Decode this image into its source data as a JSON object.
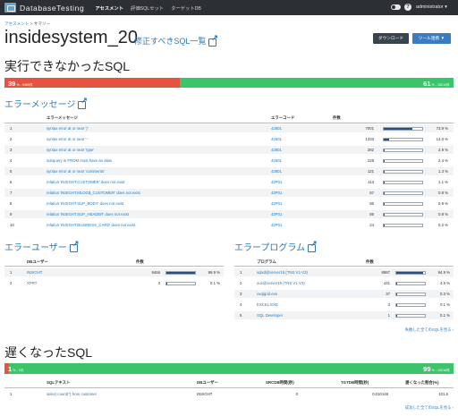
{
  "topbar": {
    "brand": "DatabaseTesting",
    "nav": [
      "アセスメント",
      "評価SQLセット",
      "ターゲットDB"
    ],
    "help": "?",
    "user": "administrator ▾"
  },
  "breadcrumb": {
    "root": "アセスメント",
    "sep": ">",
    "current": "サマリー"
  },
  "page": {
    "title": "insidesystem_20",
    "fix_link": "修正すべきSQL一覧",
    "download": "ダウンロード",
    "tools": "ツール連携 ▼"
  },
  "failed": {
    "title": "実行できなかったSQL",
    "fail_pct": "39",
    "fail_detail": "% - 9469件",
    "ok_pct": "61",
    "ok_detail": "% - 15219件",
    "fail_fraction": 0.39
  },
  "error_messages": {
    "title": "エラーメッセージ",
    "headers": [
      "エラーメッセージ",
      "エラーコード",
      "件数"
    ],
    "rows": [
      {
        "no": "1",
        "msg": "syntax error at or near ')'",
        "code": "42601",
        "count": "7001",
        "pct": "73.9 %",
        "frac": 0.739
      },
      {
        "no": "2",
        "msg": "syntax error at or near '-'",
        "code": "42601",
        "count": "1333",
        "pct": "14.0 %",
        "frac": 0.14
      },
      {
        "no": "3",
        "msg": "syntax error at or near 'type'",
        "code": "42601",
        "count": "282",
        "pct": "2.9 %",
        "frac": 0.029
      },
      {
        "no": "4",
        "msg": "subquery in FROM must have an alias",
        "code": "42601",
        "count": "228",
        "pct": "2.4 %",
        "frac": 0.024
      },
      {
        "no": "5",
        "msg": "syntax error at or near 'comments'",
        "code": "42601",
        "count": "121",
        "pct": "1.3 %",
        "frac": 0.013
      },
      {
        "no": "6",
        "msg": "relation 'INSIGHT.CUSTOMER' does not exist",
        "code": "42P01",
        "count": "113",
        "pct": "1.1 %",
        "frac": 0.011
      },
      {
        "no": "7",
        "msg": "relation 'INSIGHT.MLOG$_CUSTOMER' does not exist",
        "code": "42P01",
        "count": "87",
        "pct": "0.9 %",
        "frac": 0.009
      },
      {
        "no": "8",
        "msg": "relation 'INSIGHT.SUP_BODY' does not exist",
        "code": "42P01",
        "count": "86",
        "pct": "0.9 %",
        "frac": 0.009
      },
      {
        "no": "9",
        "msg": "relation 'INSIGHT.SUP_HEADER' does not exist",
        "code": "42P01",
        "count": "86",
        "pct": "0.9 %",
        "frac": 0.009
      },
      {
        "no": "10",
        "msg": "relation 'INSIGHT.BUSINESS_CARD' does not exist",
        "code": "42P01",
        "count": "24",
        "pct": "0.2 %",
        "frac": 0.002
      }
    ]
  },
  "error_users": {
    "title": "エラーユーザー",
    "headers": [
      "DBユーザー",
      "件数"
    ],
    "rows": [
      {
        "no": "1",
        "name": "INSIGHT",
        "count": "9466",
        "pct": "99.9 %",
        "frac": 0.999
      },
      {
        "no": "2",
        "name": "XPRT",
        "count": "3",
        "pct": "0.1 %",
        "frac": 0.001
      }
    ]
  },
  "error_programs": {
    "title": "エラープログラム",
    "headers": [
      "プログラム",
      "件数"
    ],
    "rows": [
      {
        "no": "1",
        "name": "sqlxd@server19 (TNS V1-V3)",
        "count": "8987",
        "pct": "94.9 %",
        "frac": 0.949
      },
      {
        "no": "2",
        "name": "oux@server19 (TNS V1-V3)",
        "count": "441",
        "pct": "4.6 %",
        "frac": 0.046
      },
      {
        "no": "3",
        "name": "oxqlgrid.exe",
        "count": "37",
        "pct": "0.3 %",
        "frac": 0.003
      },
      {
        "no": "4",
        "name": "EXCEL.EXE",
        "count": "3",
        "pct": "0.1 %",
        "frac": 0.001
      },
      {
        "no": "5",
        "name": "SQL Developer",
        "count": "1",
        "pct": "0.1 %",
        "frac": 0.001
      }
    ],
    "more": "失敗した全てのSQLを見る ›"
  },
  "slow": {
    "title": "遅くなったSQL",
    "fail_pct": "1",
    "fail_detail": "% - 1件",
    "ok_pct": "99",
    "ok_detail": "% - 15218件",
    "fail_fraction": 0.01,
    "headers": [
      "SQLテキスト",
      "DBユーザー",
      "SRCDB時間(秒)",
      "TGTDB時間(秒)",
      "遅くなった割合(%)"
    ],
    "rows": [
      {
        "no": "1",
        "sql": "select count(*) from customer",
        "user": "INSIGHT",
        "src": "0",
        "tgt": "0.010148",
        "ratio": "101.5"
      }
    ],
    "more": "成功した全てのSQLを見る ›"
  }
}
